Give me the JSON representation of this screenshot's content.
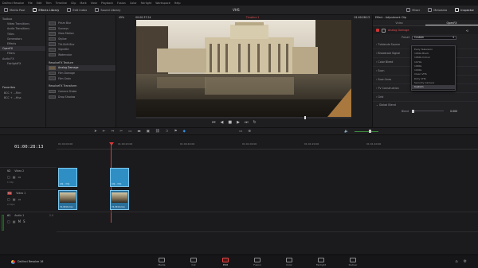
{
  "menubar": {
    "items": [
      "DaVinci Resolve",
      "File",
      "Edit",
      "Trim",
      "Timeline",
      "Clip",
      "Mark",
      "View",
      "Playback",
      "Fusion",
      "Color",
      "Fairlight",
      "Workspace",
      "Help"
    ]
  },
  "toolbar": {
    "media_pool": "Media Pool",
    "effects_library": "Effects Library",
    "edit_index": "Edit Index",
    "sound_library": "Sound Library",
    "project_title": "VHS",
    "mixer": "Mixer",
    "metadata": "Metadata",
    "inspector": "Inspector"
  },
  "viewer": {
    "zoom": "45%",
    "timecode_left": "00:00:37:24",
    "timeline_name": "Timeline 1",
    "timecode_right": "01:00:28:13"
  },
  "toolbox": {
    "items": [
      "Toolbox",
      "Video Transitions",
      "Audio Transitions",
      "Titles",
      "Generators",
      "Effects",
      "OpenFX",
      "Filters",
      "Audio FX",
      "FairlightFX"
    ],
    "selected_index": 6
  },
  "favorites": {
    "title": "Favorites",
    "items": [
      "BCC + ...Film",
      "BCC + ...Hiss"
    ]
  },
  "effects_list": {
    "items_top": [
      "Prism Blur",
      "Sunrays",
      "Glow Motion",
      "Stylize",
      "Tilt-Shift Blur",
      "Vignette",
      "Watercolor"
    ],
    "section_texture": "ResolveFX Texture",
    "items_texture": [
      "Analog Damage",
      "Film Damage",
      "Film Grain"
    ],
    "selected": "Analog Damage",
    "section_transform": "ResolveFX Transform",
    "items_transform": [
      "Camera Shake",
      "Drop Shadow"
    ]
  },
  "inspector": {
    "header": "Effect - Adjustment Clip",
    "tab_video": "Video",
    "tab_openfx": "OpenFX",
    "effect_name": "Analog Damage",
    "preset_label": "Preset",
    "preset_value": "Custom",
    "sections": [
      "Tvblende Source",
      "Broadcast Signal",
      "Color Bleed",
      "Scan",
      "Scan lines",
      "TV Construction",
      "Grid",
      "Global Blend"
    ],
    "blend_label": "Blend",
    "blend_value": "0.000",
    "dropdown": [
      "Early Television",
      "1960s Black",
      "1960s Colour",
      "1970s",
      "1980s",
      "1990s",
      "Clean VHS",
      "Dirty VHS",
      "Security Camera",
      "Custom"
    ]
  },
  "timeline": {
    "timecode": "01:00:28:13",
    "ruler": [
      "01:00:00:00",
      "01:00:20:00",
      "01:00:40:00",
      "01:01:00:00",
      "01:01:20:00",
      "01:01:40:00"
    ],
    "tracks": {
      "v2": {
        "id": "V2",
        "name": "Video 2",
        "clips": "1 Clip"
      },
      "v1": {
        "id": "V1",
        "name": "Video 1",
        "clips": "2 Clips"
      },
      "a1": {
        "id": "A1",
        "name": "Audio 1",
        "level": "2.0"
      }
    },
    "clip_labels": [
      "Adj... Clip",
      "Adj... Clip",
      "V1-0010.mov",
      "V1-0010.mov"
    ]
  },
  "pages": {
    "product": "DaVinci Resolve 16",
    "items": [
      "Media",
      "Cut",
      "Edit",
      "Fusion",
      "Color",
      "Fairlight",
      "Deliver"
    ],
    "active": "Edit"
  }
}
